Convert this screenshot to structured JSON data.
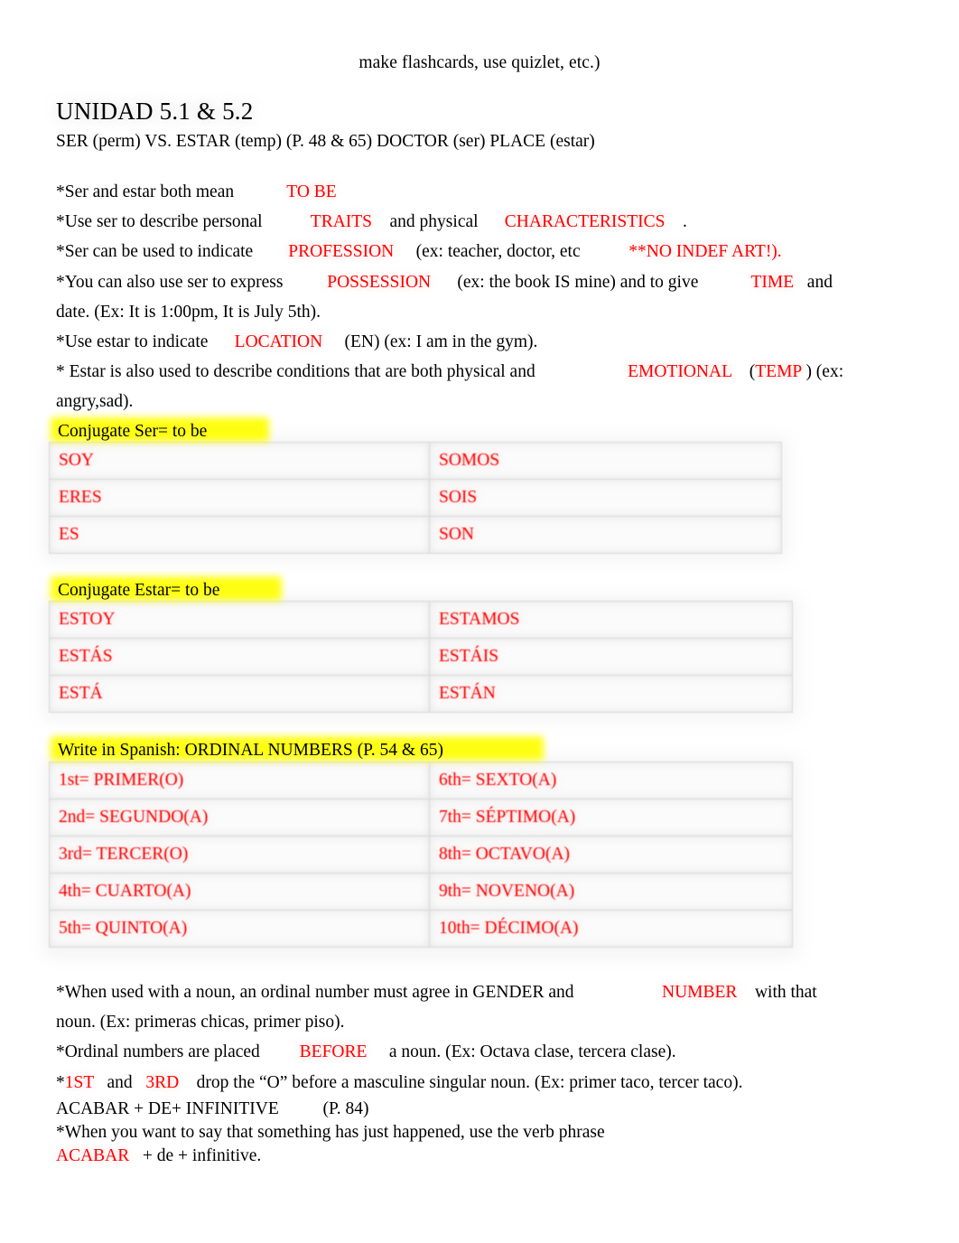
{
  "page": {
    "top_note": "make flashcards, use quizlet, etc.)",
    "title": "UNIDAD 5.1 & 5.2",
    "subtitle": "SER (perm) VS. ESTAR (temp) (P. 48 & 65) DOCTOR (ser) PLACE (estar)"
  },
  "notes": {
    "line1_a": "*Ser and estar both mean            ",
    "line1_red": "TO BE",
    "line2_a": "*Use ser to describe personal           ",
    "line2_red1": "TRAITS",
    "line2_b": "    and physical      ",
    "line2_red2": "CHARACTERISTICS",
    "line2_c": "    .",
    "line3_a": "*Ser can be used to indicate        ",
    "line3_red1": "PROFESSION",
    "line3_b": "     (ex: teacher, doctor, etc           ",
    "line3_red2": "**NO INDEF ART!).",
    "line4_a": "*You can also use ser to express          ",
    "line4_red1": "POSSESSION",
    "line4_b": "      (ex: the book IS mine) and to give            ",
    "line4_red2": "TIME",
    "line4_c": "   and",
    "line5": "date. (Ex: It is 1:00pm, It is July 5th).",
    "line6_a": "*Use estar to indicate      ",
    "line6_red": "LOCATION",
    "line6_b": "     (EN) (ex: I am in the gym).",
    "line7_a": "* Estar is also used to describe conditions that are both physical and                     ",
    "line7_red1": "EMOTIONAL",
    "line7_b": "    (",
    "line7_red2": "TEMP",
    "line7_c": " ) (ex:",
    "line8": "angry,sad)."
  },
  "section_ser": {
    "heading": "Conjugate Ser= to be",
    "rows": [
      {
        "left": "SOY",
        "right": "SOMOS"
      },
      {
        "left": "ERES",
        "right": "SOIS"
      },
      {
        "left": "ES",
        "right": "SON"
      }
    ]
  },
  "section_estar": {
    "heading": "Conjugate Estar= to be",
    "rows": [
      {
        "left": "ESTOY",
        "right": "ESTAMOS"
      },
      {
        "left": "ESTÁS",
        "right": "ESTÁIS"
      },
      {
        "left": "ESTÁ",
        "right": "ESTÁN"
      }
    ]
  },
  "section_ordinals": {
    "heading": "Write in Spanish: ORDINAL NUMBERS (P. 54 & 65)",
    "rows": [
      {
        "left": "1st= PRIMER(O)",
        "right": "6th= SEXTO(A)"
      },
      {
        "left": "2nd= SEGUNDO(A)",
        "right": "7th= SÉPTIMO(A)"
      },
      {
        "left": "3rd= TERCER(O)",
        "right": "8th= OCTAVO(A)"
      },
      {
        "left": "4th= CUARTO(A)",
        "right": "9th= NOVENO(A)"
      },
      {
        "left": "5th= QUINTO(A)",
        "right": "10th= DÉCIMO(A)"
      }
    ]
  },
  "bottom": {
    "line1_a": "*When used with a noun, an ordinal number must agree in GENDER and                    ",
    "line1_red": "NUMBER",
    "line1_b": "    with that",
    "line2": "noun. (Ex: primeras chicas, primer piso).",
    "line3_a": "*Ordinal numbers are placed         ",
    "line3_red": "BEFORE",
    "line3_b": "     a noun. (Ex: Octava clase, tercera clase).",
    "line4_a": "*",
    "line4_red1": "1ST",
    "line4_b": "   and   ",
    "line4_red2": "3RD",
    "line4_c": "    drop the “O” before a masculine singular noun. (Ex: primer taco, tercer taco).",
    "line5": "ACABAR + DE+ INFINITIVE          (P. 84)",
    "line6": "*When you want to say that something has just happened, use the verb phrase",
    "line7_red": "ACABAR",
    "line7_b": "   + de + infinitive."
  },
  "colors": {
    "red": "#ff0000",
    "highlight": "#ffff00",
    "table_border": "#d9d9d9"
  }
}
